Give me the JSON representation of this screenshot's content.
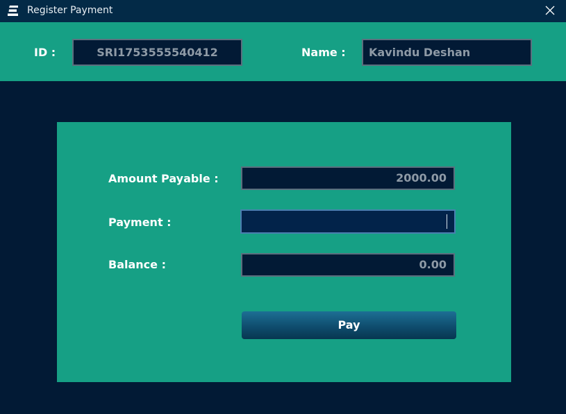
{
  "window": {
    "title": "Register Payment",
    "icon": "app-logo-icon",
    "close_icon": "close-icon"
  },
  "header": {
    "id_label": "ID :",
    "id_value": "SRI1753555540412",
    "name_label": "Name :",
    "name_value": "Kavindu Deshan"
  },
  "form": {
    "amount_label": "Amount Payable :",
    "amount_value": "2000.00",
    "payment_label": "Payment :",
    "payment_value": "",
    "balance_label": "Balance :",
    "balance_value": "0.00",
    "pay_label": "Pay"
  },
  "colors": {
    "background": "#021a35",
    "titlebar": "#032a47",
    "accent": "#16a085",
    "field_bg": "#021a35",
    "field_border": "#5b6f7e",
    "focus_border": "#4a7fb0",
    "button_top": "#1d6f94",
    "button_bottom": "#073650"
  }
}
